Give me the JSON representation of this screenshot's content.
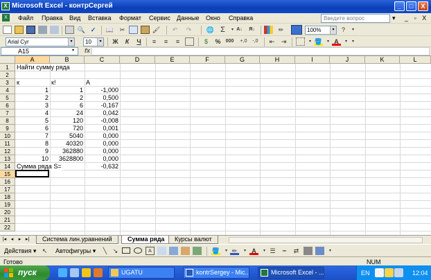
{
  "window": {
    "title": "Microsoft Excel - контрСергей",
    "minimize_label": "_",
    "maximize_label": "□",
    "close_label": "X"
  },
  "menu": {
    "items": [
      "Файл",
      "Правка",
      "Вид",
      "Вставка",
      "Формат",
      "Сервис",
      "Данные",
      "Окно",
      "Справка"
    ],
    "help_placeholder": "Введите вопрос",
    "help_dropdown": "▾",
    "doc_controls": "_ ▫ X"
  },
  "toolbar": {
    "zoom": "100%",
    "font_name": "Arial Cyr",
    "font_size": "10",
    "bold": "Ж",
    "italic": "К",
    "underline": "Ч",
    "sigma": "Σ",
    "percent": "%",
    "thousands": "000"
  },
  "formula_bar": {
    "name_box": "A15",
    "fx": "fx",
    "value": ""
  },
  "sheet": {
    "columns": [
      "A",
      "B",
      "C",
      "D",
      "E",
      "F",
      "G",
      "H",
      "I",
      "J",
      "K",
      "L"
    ],
    "rows": [
      "1",
      "2",
      "3",
      "4",
      "5",
      "6",
      "7",
      "8",
      "9",
      "10",
      "11",
      "12",
      "13",
      "14",
      "15",
      "16",
      "17",
      "18",
      "19",
      "20",
      "21",
      "22"
    ],
    "active_cell": "A15",
    "title_text": "Найти сумму ряда",
    "header_k": "к",
    "header_kfact": "к!",
    "header_a": "A",
    "data_rows": [
      {
        "k": "1",
        "f": "1",
        "a": "-1,000"
      },
      {
        "k": "2",
        "f": "2",
        "a": "0,500"
      },
      {
        "k": "3",
        "f": "6",
        "a": "-0,167"
      },
      {
        "k": "4",
        "f": "24",
        "a": "0,042"
      },
      {
        "k": "5",
        "f": "120",
        "a": "-0,008"
      },
      {
        "k": "6",
        "f": "720",
        "a": "0,001"
      },
      {
        "k": "7",
        "f": "5040",
        "a": "0,000"
      },
      {
        "k": "8",
        "f": "40320",
        "a": "0,000"
      },
      {
        "k": "9",
        "f": "362880",
        "a": "0,000"
      },
      {
        "k": "10",
        "f": "3628800",
        "a": "0,000"
      }
    ],
    "sum_label": "Сумма ряда S=",
    "sum_value": "-0,632"
  },
  "sheet_tabs": {
    "nav": [
      "|◂",
      "◂",
      "▸",
      "▸|"
    ],
    "tabs": [
      "Система лин.уравнений",
      "Сумма ряда",
      "Курсы валют"
    ],
    "active": "Сумма ряда"
  },
  "drawing_toolbar": {
    "actions": "Действия ▾",
    "autoshapes": "Автофигуры ▾"
  },
  "status": {
    "ready": "Готово",
    "num": "NUM"
  },
  "taskbar": {
    "start": "пуск",
    "tasks": [
      "UGATU",
      "kontrSergey - Mic...",
      "Microsoft Excel - ..."
    ],
    "lang": "EN",
    "clock": "12:04"
  },
  "colors": {
    "titlebar": "#0a3fb8",
    "taskbar": "#245edb",
    "start": "#2f8a2f",
    "selected_header": "#fdd9a0"
  }
}
